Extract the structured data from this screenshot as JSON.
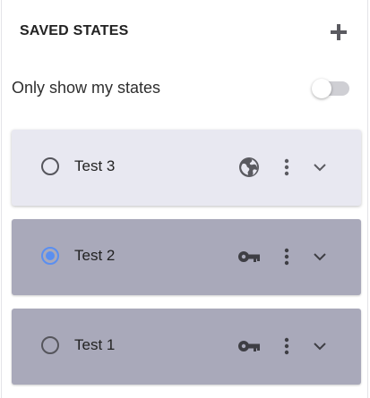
{
  "header": {
    "title": "SAVED STATES",
    "add_icon": "plus-icon"
  },
  "filter": {
    "label": "Only show my states",
    "toggle_on": false
  },
  "states": [
    {
      "name": "Test 3",
      "selected": false,
      "visibility_icon": "globe-icon",
      "highlighted": true
    },
    {
      "name": "Test 2",
      "selected": true,
      "visibility_icon": "key-icon",
      "highlighted": false
    },
    {
      "name": "Test 1",
      "selected": false,
      "visibility_icon": "key-icon",
      "highlighted": false
    }
  ],
  "colors": {
    "card_highlight": "#e8e8f1",
    "card_default": "#a9a9ba",
    "radio_selected": "#5b8ff0",
    "icon": "#5a5a60"
  }
}
